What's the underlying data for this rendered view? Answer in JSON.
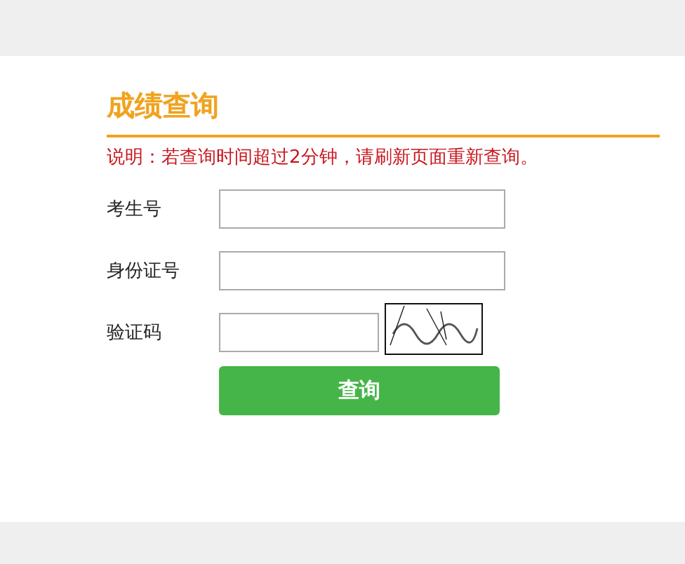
{
  "title": "成绩查询",
  "note": "说明：若查询时间超过2分钟，请刷新页面重新查询。",
  "fields": [
    {
      "label": "考生号",
      "kind": "text"
    },
    {
      "label": "身份证号",
      "kind": "text"
    },
    {
      "label": "验证码",
      "kind": "captcha"
    }
  ],
  "submit": "查询"
}
